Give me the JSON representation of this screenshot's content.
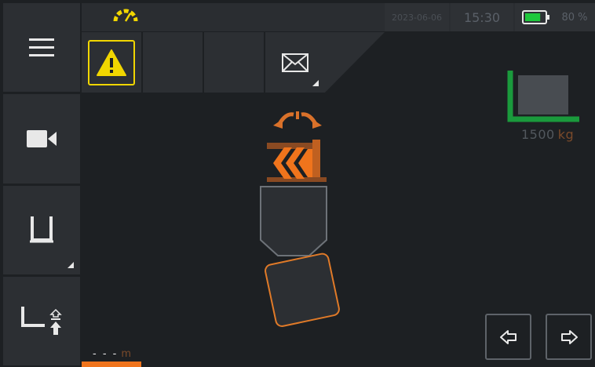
{
  "status": {
    "date": "2023-06-06",
    "time": "15:30",
    "battery_percent": "80 %",
    "battery_level": 0.8
  },
  "sidebar": {
    "items": [
      {
        "icon": "menu-icon"
      },
      {
        "icon": "camera-icon"
      },
      {
        "icon": "implement-icon"
      },
      {
        "icon": "hitch-lift-icon"
      }
    ]
  },
  "toolbar": {
    "items": [
      {
        "icon": "warning-icon"
      },
      {
        "icon": ""
      },
      {
        "icon": ""
      },
      {
        "icon": "mail-icon"
      }
    ]
  },
  "load": {
    "value": "1500",
    "unit": "kg"
  },
  "distance": {
    "value": "- - -",
    "unit": "m"
  },
  "colors": {
    "accent": "#f0741c",
    "warning": "#f1d600",
    "battery": "#1ec83c",
    "load_frame": "#1a9a3c"
  }
}
